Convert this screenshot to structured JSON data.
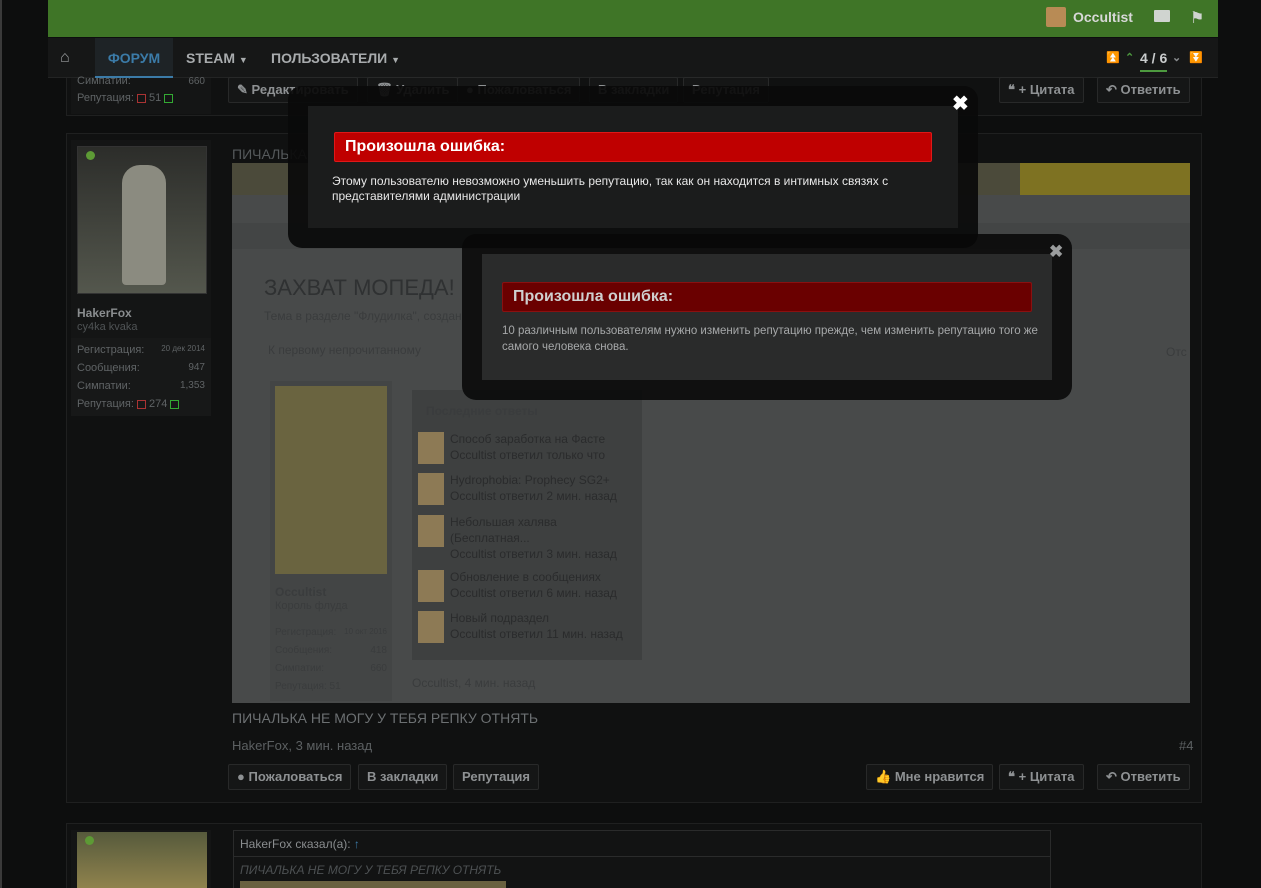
{
  "header": {
    "username": "Occultist"
  },
  "nav": {
    "forum": "ФОРУМ",
    "steam": "STEAM",
    "users": "ПОЛЬЗОВАТЕЛИ",
    "pager": "4 / 6"
  },
  "prev_post": {
    "sympathy_label": "Симпатии:",
    "sympathy_value": "660",
    "rep_label": "Репутация:",
    "rep_value": "51",
    "actions": {
      "edit": "Редактировать",
      "delete": "Удалить",
      "report": "Пожаловаться",
      "bookmark": "В закладки",
      "rep": "Репутация",
      "quote": "+ Цитата",
      "reply": "Ответить"
    }
  },
  "post": {
    "author": "HakerFox",
    "title": "cy4ka kvaka",
    "reg_label": "Регистрация:",
    "reg_value": "20 дек 2014",
    "msgs_label": "Сообщения:",
    "msgs_value": "947",
    "sym_label": "Симпатии:",
    "sym_value": "1,353",
    "rep_label": "Репутация:",
    "rep_value": "274",
    "heading": "ПИЧАЛЬКА НЕ",
    "body": "ПИЧАЛЬКА НЕ МОГУ У ТЕБЯ РЕПКУ ОТНЯТЬ",
    "meta": "HakerFox, 3 мин. назад",
    "num": "#4",
    "actions": {
      "report": "Пожаловаться",
      "bookmark": "В закладки",
      "rep": "Репутация",
      "dislike": "Мне нравится",
      "quote": "+ Цитата",
      "reply": "Ответить"
    }
  },
  "screenshot": {
    "thread_title": "ЗАХВАТ МОПЕДА!",
    "thread_sub": "Тема в разделе \"Флудилка\", создан",
    "first_unread": "К первому непрочитанному",
    "cut_right": "Отс",
    "recent_header": "Последние ответы",
    "recent": [
      {
        "title": "Способ заработка на Фасте",
        "user": "Occultist",
        "meta": "ответил только что"
      },
      {
        "title": "Hydrophobia: Prophecy SG2+",
        "user": "Occultist",
        "meta": "ответил 2 мин. назад"
      },
      {
        "title": "Небольшая халява",
        "title2": "(Бесплатная...",
        "user": "Occultist",
        "meta": "ответил 3 мин. назад"
      },
      {
        "title": "Обновление в сообщениях",
        "user": "Occultist",
        "meta": "ответил 6 мин. назад"
      },
      {
        "title": "Новый подраздел",
        "user": "Occultist",
        "meta": "ответил 11 мин. назад"
      }
    ],
    "author": "Occultist",
    "author_title": "Король флуда",
    "reg_label": "Регистрация:",
    "reg_value": "10 окт 2016",
    "msgs_label": "Сообщения:",
    "msgs_value": "418",
    "sym_label": "Симпатии:",
    "sym_value": "660",
    "rep_label": "Репутация:",
    "rep_value": "51",
    "footer_meta": "Occultist, 4 мин. назад"
  },
  "quote": {
    "header": "HakerFox сказал(а):",
    "text": "ПИЧАЛЬКА НЕ МОГУ У ТЕБЯ РЕПКУ ОТНЯТЬ"
  },
  "modal1": {
    "title": "Произошла ошибка:",
    "text_line1": "Этому пользователю невозможно уменьшить репутацию, так как он находится в интимных связях с",
    "text_line2": "представителями администрации"
  },
  "modal2": {
    "title": "Произошла ошибка:",
    "text_line1": "10 различным пользователям нужно изменить репутацию прежде, чем изменить репутацию того же",
    "text_line2": "самого человека снова."
  },
  "colors": {
    "topbar": "#3f7527",
    "error": "#bf0000",
    "accent": "#3b7ba8"
  }
}
